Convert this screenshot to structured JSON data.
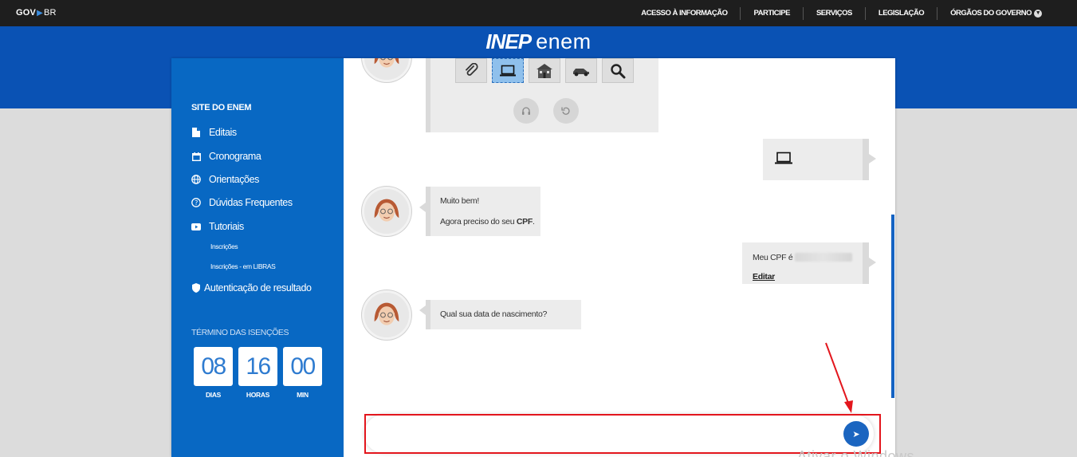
{
  "govbar": {
    "logo_gov": "GOV",
    "logo_br": "BR",
    "nav": [
      {
        "label": "ACESSO À INFORMAÇÃO"
      },
      {
        "label": "PARTICIPE"
      },
      {
        "label": "SERVIÇOS"
      },
      {
        "label": "LEGISLAÇÃO"
      },
      {
        "label": "ÓRGÃOS DO GOVERNO"
      }
    ]
  },
  "header": {
    "brand_inep": "INEP",
    "brand_enem": "enem"
  },
  "sidebar": {
    "title": "SITE DO ENEM",
    "items": [
      {
        "label": "Editais",
        "icon": "document-icon"
      },
      {
        "label": "Cronograma",
        "icon": "calendar-icon"
      },
      {
        "label": "Orientações",
        "icon": "globe-icon"
      },
      {
        "label": "Dúvidas Frequentes",
        "icon": "question-icon"
      },
      {
        "label": "Tutoriais",
        "icon": "youtube-icon"
      }
    ],
    "subitems": [
      {
        "label": "Inscrições"
      },
      {
        "label": "Inscrições - em LIBRAS"
      }
    ],
    "auth": {
      "label": "Autenticação de resultado",
      "icon": "shield-icon"
    },
    "countdown": {
      "title": "TÉRMINO DAS ISENÇÕES",
      "days": "08",
      "days_label": "DIAS",
      "hours": "16",
      "hours_label": "HORAS",
      "minutes": "00",
      "minutes_label": "MIN"
    }
  },
  "chat": {
    "icon_options": [
      "paperclip-icon",
      "laptop-icon",
      "house-icon",
      "car-icon",
      "magnifier-icon"
    ],
    "controls": [
      "headphones-icon",
      "undo-icon"
    ],
    "messages": [
      {
        "from": "user",
        "icon": "laptop-icon"
      },
      {
        "from": "bot",
        "line1": "Muito bem!",
        "line2_prefix": "Agora preciso do seu ",
        "line2_bold": "CPF",
        "line2_suffix": "."
      },
      {
        "from": "user",
        "text": "Meu CPF é",
        "link": "Editar"
      },
      {
        "from": "bot",
        "text": "Qual sua data de nascimento?"
      }
    ],
    "input": {
      "value": "",
      "placeholder": ""
    }
  },
  "colors": {
    "header_blue": "#0a52b4",
    "sidebar_blue": "#0868c3",
    "annotation_red": "#e3161d"
  },
  "watermark": "Ativar o Windows"
}
